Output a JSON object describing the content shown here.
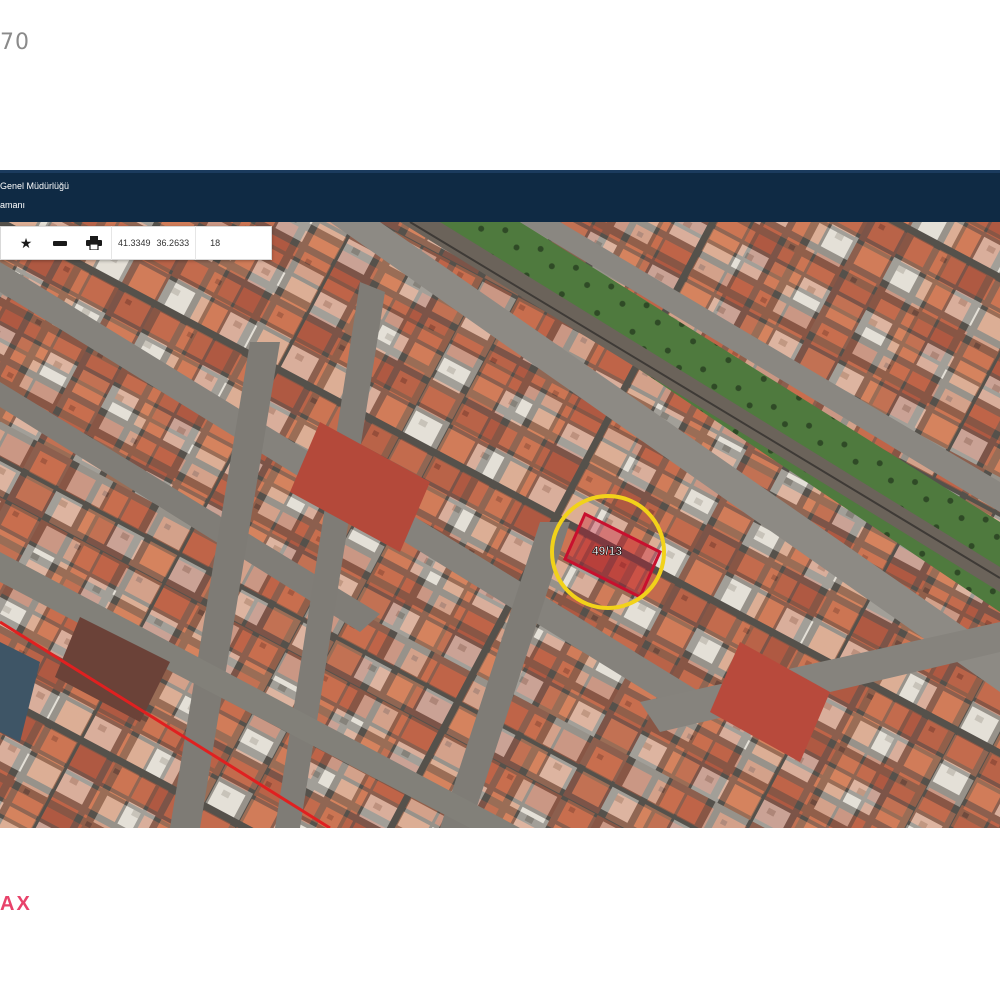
{
  "page": {
    "top_number": "70",
    "brand_fragment": "AX"
  },
  "header": {
    "line1": "Genel Müdürlüğü",
    "line2": "amanı"
  },
  "toolbar": {
    "favorite_icon": "star-icon",
    "measure_icon": "ruler-icon",
    "print_icon": "printer-icon",
    "latitude": "41.3349",
    "longitude": "36.2633",
    "zoom": "18"
  },
  "map": {
    "parcel_label": "49/13",
    "highlight_color": "#f2d21a",
    "parcel_color": "#c8102e",
    "boundary_color": "#e02020"
  }
}
